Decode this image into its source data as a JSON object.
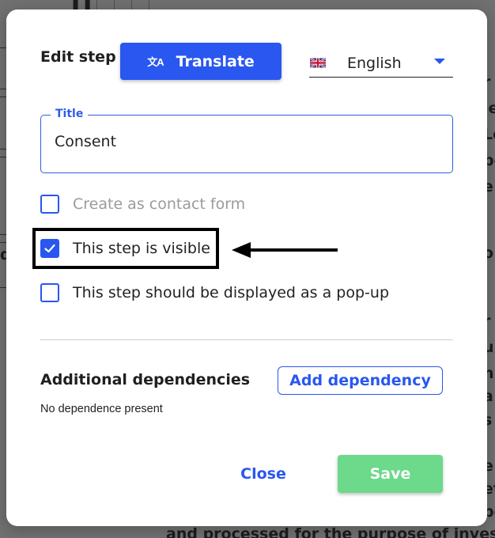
{
  "dialog": {
    "title": "Edit step",
    "translate_button": {
      "label": "Translate",
      "icon": "translate-icon"
    },
    "language_select": {
      "selected": "English",
      "flag": "uk-flag-icon"
    },
    "title_field": {
      "label": "Title",
      "value": "Consent"
    },
    "checkboxes": [
      {
        "label": "Create as contact form",
        "checked": false,
        "disabled": true
      },
      {
        "label": "This step is visible",
        "checked": true,
        "disabled": false,
        "highlighted": true
      },
      {
        "label": "This step should be displayed as a pop-up",
        "checked": false,
        "disabled": false
      }
    ],
    "dependencies": {
      "heading": "Additional dependencies",
      "empty_text": "No dependence present",
      "add_button": "Add dependency"
    },
    "footer": {
      "close_label": "Close",
      "save_label": "Save"
    }
  },
  "background": {
    "right_edge_fragments": [
      "r",
      "le",
      "Le",
      "be",
      "e",
      "o",
      "r",
      "ur",
      "nh",
      "a",
      "s",
      "e",
      "et",
      "be"
    ],
    "left_edge_fragments": [
      "d"
    ],
    "bottom_text": "and processed for the purpose of investig"
  },
  "colors": {
    "primary": "#2957f0",
    "save_green": "#6cd98b",
    "overlay": "#707070"
  }
}
